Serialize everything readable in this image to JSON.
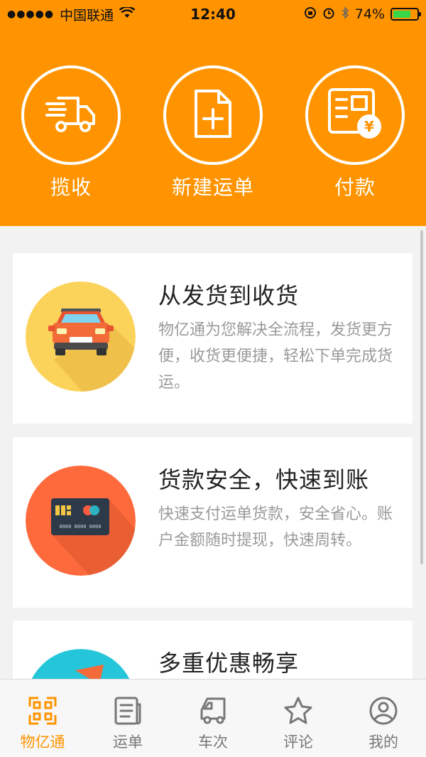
{
  "status_bar": {
    "carrier": "中国联通",
    "time": "12:40",
    "battery": "74%",
    "battery_level": 0.74
  },
  "actions": [
    {
      "label": "揽收",
      "icon": "delivery-truck-icon"
    },
    {
      "label": "新建运单",
      "icon": "new-document-icon"
    },
    {
      "label": "付款",
      "icon": "payment-receipt-icon"
    }
  ],
  "cards": [
    {
      "title": "从发货到收货",
      "desc": "物亿通为您解决全流程，发货更方便，收货更便捷，轻松下单完成货运。",
      "icon": "car-illustration"
    },
    {
      "title": "货款安全，快速到账",
      "desc": "快速支付运单货款，安全省心。账户金额随时提现，快速周转。",
      "icon": "bank-card-illustration",
      "card_number": "0000 0000 0000"
    },
    {
      "title": "多重优惠畅享",
      "desc": "",
      "icon": "discount-illustration"
    }
  ],
  "tabs": [
    {
      "label": "物亿通",
      "icon": "grid-home-icon",
      "active": true
    },
    {
      "label": "运单",
      "icon": "waybill-icon",
      "active": false
    },
    {
      "label": "车次",
      "icon": "truck-trip-icon",
      "active": false
    },
    {
      "label": "评论",
      "icon": "star-icon",
      "active": false
    },
    {
      "label": "我的",
      "icon": "user-profile-icon",
      "active": false
    }
  ],
  "colors": {
    "accent": "#ff9400",
    "car_circle": "#fcd35a",
    "card_circle": "#ff6a3d",
    "discount_circle": "#26c6da"
  }
}
